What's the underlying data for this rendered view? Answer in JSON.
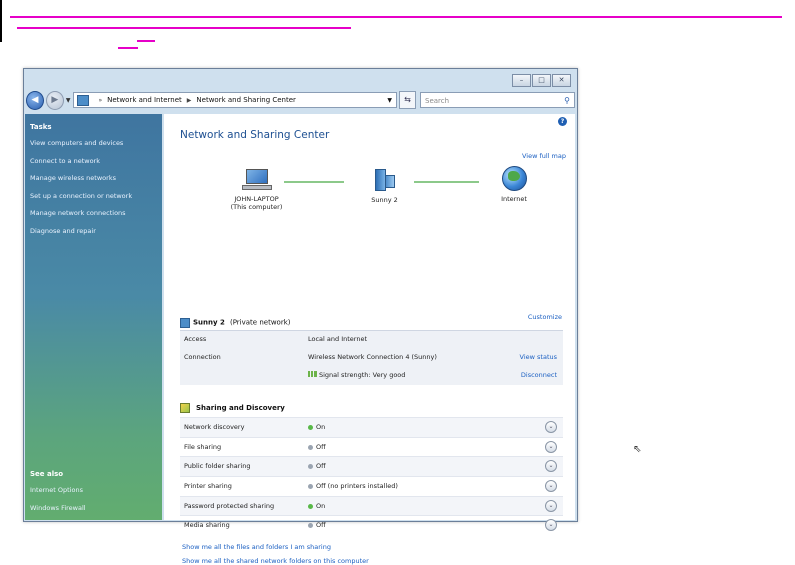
{
  "annotation": {
    "color": "#e600c8"
  },
  "window": {
    "controls": [
      "–",
      "□",
      "✕"
    ],
    "address": {
      "crumbs": [
        "Network and Internet",
        "Network and Sharing Center"
      ]
    },
    "search_placeholder": "Search"
  },
  "sidebar": {
    "tasks_heading": "Tasks",
    "tasks": [
      "View computers and devices",
      "Connect to a network",
      "Manage wireless networks",
      "Set up a connection or network",
      "Manage network connections",
      "Diagnose and repair"
    ],
    "see_also_heading": "See also",
    "see_also": [
      "Internet Options",
      "Windows Firewall"
    ]
  },
  "content": {
    "title": "Network and Sharing Center",
    "view_full_map": "View full map",
    "map": {
      "computer_name": "JOHN-LAPTOP",
      "computer_sub": "(This computer)",
      "network_name": "Sunny 2",
      "internet_label": "Internet"
    },
    "network": {
      "name": "Sunny 2",
      "type": "(Private network)",
      "customize": "Customize",
      "rows": [
        {
          "key": "Access",
          "value": "Local and Internet",
          "action": ""
        },
        {
          "key": "Connection",
          "value": "Wireless Network Connection 4 (Sunny)",
          "action": "View status"
        },
        {
          "key": "",
          "value": "Signal strength: Very good",
          "action": "Disconnect"
        }
      ]
    },
    "sharing": {
      "heading": "Sharing and Discovery",
      "rows": [
        {
          "key": "Network discovery",
          "value": "On",
          "on": true
        },
        {
          "key": "File sharing",
          "value": "Off",
          "on": false
        },
        {
          "key": "Public folder sharing",
          "value": "Off",
          "on": false
        },
        {
          "key": "Printer sharing",
          "value": "Off (no printers installed)",
          "on": false
        },
        {
          "key": "Password protected sharing",
          "value": "On",
          "on": true
        },
        {
          "key": "Media sharing",
          "value": "Off",
          "on": false
        }
      ]
    },
    "links": [
      "Show me all the files and folders I am sharing",
      "Show me all the shared network folders on this computer"
    ]
  }
}
